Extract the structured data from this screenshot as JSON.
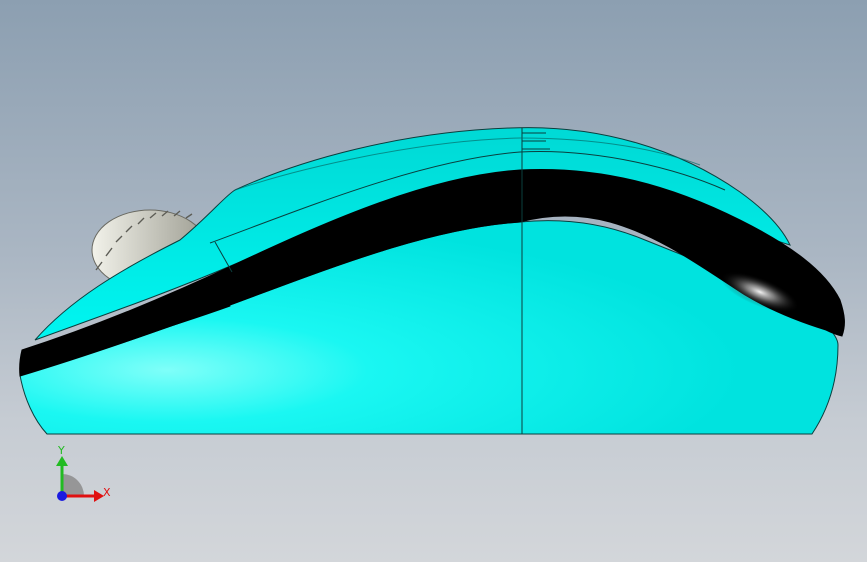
{
  "viewport": {
    "background_top": "#8c9fb1",
    "background_bottom": "#d3d6da",
    "model": {
      "body_color": "#00f0ec",
      "body_highlight": "#7ffff9",
      "stripe_color": "#000000",
      "edge_color": "#0a3f3e",
      "wheel_color": "#d8d8cf"
    }
  },
  "triad": {
    "y_label": "Y",
    "x_label": "X",
    "y_color": "#22bb22",
    "x_color": "#e01010",
    "z_color": "#1a1ae0"
  }
}
